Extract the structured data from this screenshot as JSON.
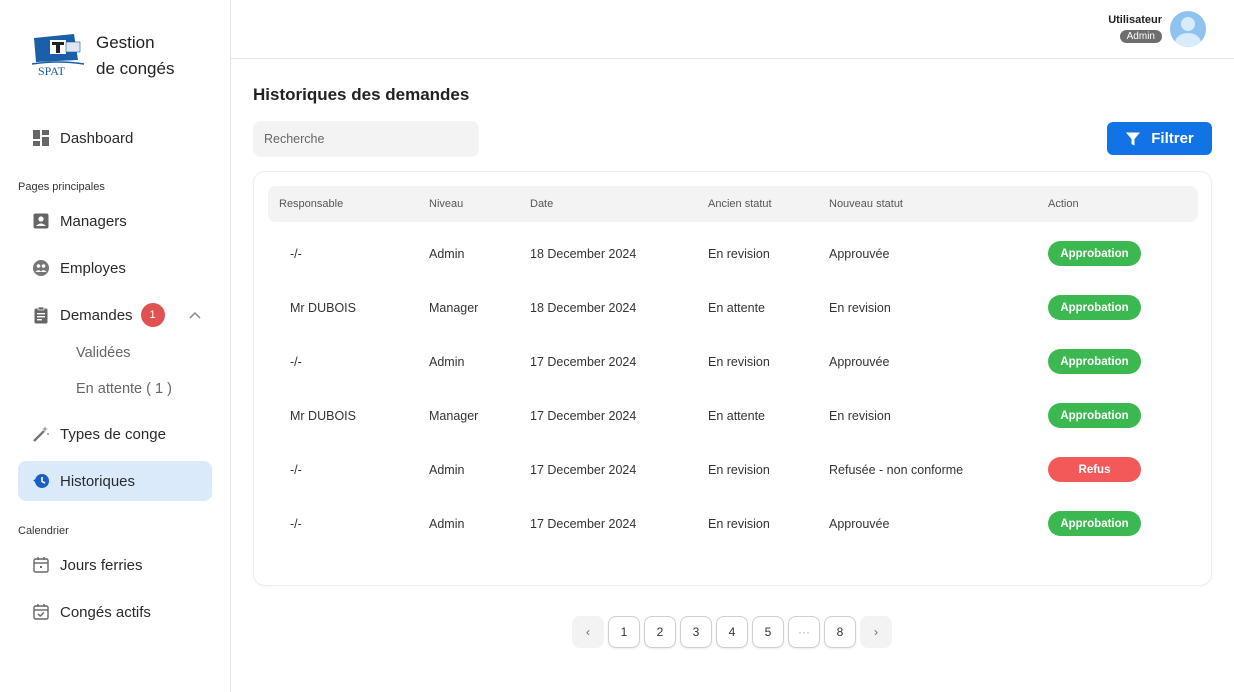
{
  "brand": {
    "logo_text": "SPAT",
    "line1": "Gestion",
    "line2": "de congés"
  },
  "sidebar": {
    "dashboard": "Dashboard",
    "section_main": "Pages principales",
    "managers": "Managers",
    "employes": "Employes",
    "demandes": "Demandes",
    "demandes_badge": "1",
    "validees": "Validées",
    "en_attente": "En attente ( 1 )",
    "types_conge": "Types de conge",
    "historiques": "Historiques",
    "section_calendar": "Calendrier",
    "jours_feries": "Jours ferries",
    "conges_actifs": "Congés actifs"
  },
  "topbar": {
    "user_name": "Utilisateur",
    "user_role": "Admin"
  },
  "main": {
    "title": "Historiques des demandes",
    "search_placeholder": "Recherche",
    "filter_label": "Filtrer"
  },
  "table": {
    "headers": {
      "responsable": "Responsable",
      "niveau": "Niveau",
      "date": "Date",
      "ancien": "Ancien statut",
      "nouveau": "Nouveau statut",
      "action": "Action"
    },
    "rows": [
      {
        "responsable": "-/-",
        "niveau": "Admin",
        "date": "18 December 2024",
        "ancien": "En revision",
        "nouveau": "Approuvée",
        "action": "Approbation"
      },
      {
        "responsable": "Mr DUBOIS",
        "niveau": "Manager",
        "date": "18 December 2024",
        "ancien": "En attente",
        "nouveau": "En revision",
        "action": "Approbation"
      },
      {
        "responsable": "-/-",
        "niveau": "Admin",
        "date": "17 December 2024",
        "ancien": "En revision",
        "nouveau": "Approuvée",
        "action": "Approbation"
      },
      {
        "responsable": "Mr DUBOIS",
        "niveau": "Manager",
        "date": "17 December 2024",
        "ancien": "En attente",
        "nouveau": "En revision",
        "action": "Approbation"
      },
      {
        "responsable": "-/-",
        "niveau": "Admin",
        "date": "17 December 2024",
        "ancien": "En revision",
        "nouveau": "Refusée - non conforme",
        "action": "Refus"
      },
      {
        "responsable": "-/-",
        "niveau": "Admin",
        "date": "17 December 2024",
        "ancien": "En revision",
        "nouveau": "Approuvée",
        "action": "Approbation"
      }
    ]
  },
  "pagination": {
    "prev": "‹",
    "next": "›",
    "pages": [
      "1",
      "2",
      "3",
      "4",
      "5",
      "···",
      "8"
    ]
  },
  "colors": {
    "accent": "#1273e6",
    "approve": "#3cb850",
    "refuse": "#f25a5a",
    "active_nav_bg": "#dbeafb",
    "badge": "#e05252"
  }
}
